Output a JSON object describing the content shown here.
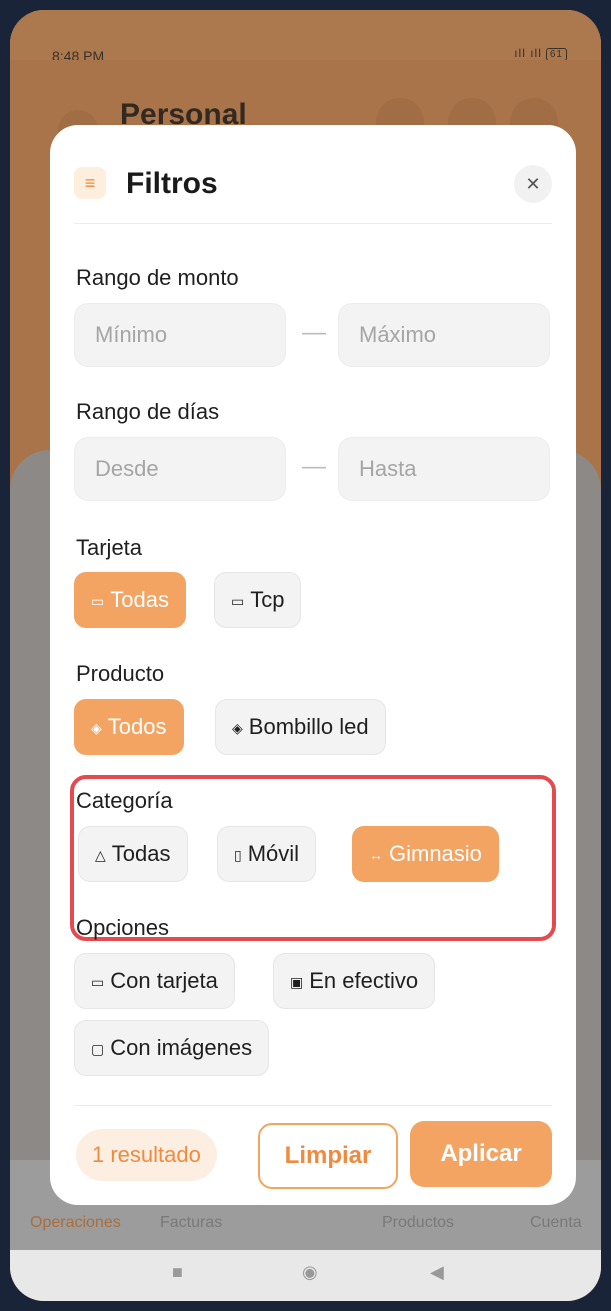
{
  "status_bar": {
    "time": "8:48 PM",
    "signal": "ıll ıll",
    "battery": "61"
  },
  "background_app": {
    "title": "Personal",
    "nav": [
      {
        "label": "Operaciones",
        "active": true
      },
      {
        "label": "Facturas",
        "active": false
      },
      {
        "label": "Productos",
        "active": false
      },
      {
        "label": "Cuenta",
        "active": false
      }
    ]
  },
  "modal": {
    "title": "Filtros",
    "amount_range": {
      "label": "Rango de monto",
      "min_placeholder": "Mínimo",
      "max_placeholder": "Máximo"
    },
    "days_range": {
      "label": "Rango de días",
      "from_placeholder": "Desde",
      "to_placeholder": "Hasta"
    },
    "card": {
      "label": "Tarjeta",
      "options": [
        {
          "label": "Todas",
          "icon": "cards-icon",
          "active": true
        },
        {
          "label": "Tcp",
          "icon": "card-icon",
          "active": false
        }
      ]
    },
    "product": {
      "label": "Producto",
      "options": [
        {
          "label": "Todos",
          "icon": "box-icon",
          "active": true
        },
        {
          "label": "Bombillo led",
          "icon": "box-icon",
          "active": false
        }
      ]
    },
    "category": {
      "label": "Categoría",
      "options": [
        {
          "label": "Todas",
          "icon": "shapes-icon",
          "active": false
        },
        {
          "label": "Móvil",
          "icon": "phone-icon",
          "active": false
        },
        {
          "label": "Gimnasio",
          "icon": "arrows-icon",
          "active": true
        }
      ]
    },
    "options": {
      "label": "Opciones",
      "items": [
        {
          "label": "Con tarjeta",
          "icon": "card-icon"
        },
        {
          "label": "En efectivo",
          "icon": "cash-icon"
        },
        {
          "label": "Con imágenes",
          "icon": "image-icon"
        }
      ]
    },
    "footer": {
      "result_count": "1 resultado",
      "clear_label": "Limpiar",
      "apply_label": "Aplicar"
    }
  },
  "colors": {
    "accent": "#f3a462",
    "highlight": "#e34b4f"
  }
}
